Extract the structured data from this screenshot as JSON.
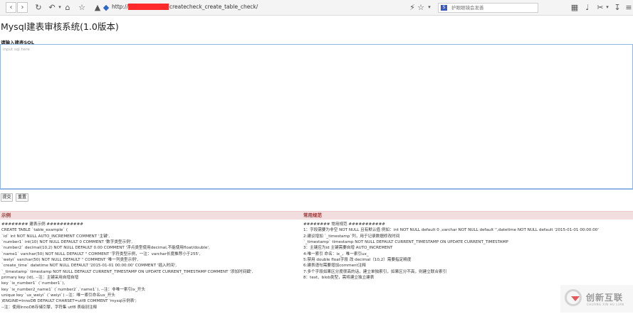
{
  "browser": {
    "url_prefix": "http://",
    "url_path": "createcheck_create_table_check/",
    "search_placeholder": "护眼眼镜会发善",
    "accent_redaction_color": "#ff2a2a"
  },
  "page": {
    "title": "Mysql建表审核系统(1.0版本)",
    "input_label": "请输入建表SQL",
    "input_placeholder": "input sql here",
    "submit_label": "提交",
    "reset_label": "重置"
  },
  "example_panel": {
    "title": "示例",
    "lines": [
      "######## 建表示例 ###########",
      "CREATE TABLE `table_example` (",
      "`id` int NOT NULL AUTO_INCREMENT COMMENT '主键',",
      "`number1` int(10) NOT NULL DEFAULT 0 COMMENT '数字类型示例',",
      "`number2` decimal(10,2) NOT NULL DEFAULT 0.00 COMMENT '浮点类型使用decimal,不能使用float/double',",
      "`name1` varchar(50) NOT NULL DEFAULT '' COMMENT '字符类型示例，一注：varchar长度推荐小于255',",
      "`weiyi` varchar(50) NOT NULL DEFAULT '' COMMENT '唯一列类型示例',",
      "`create_time` datetime NOT NULL DEFAULT '2015-01-01 00:00:00' COMMENT '插入时间',",
      "`_timestamp` timestamp NOT NULL DEFAULT CURRENT_TIMESTAMP ON UPDATE CURRENT_TIMESTAMP COMMENT '添加时间戳',",
      "primary key (id), --注：主键采用自增自增",
      "key `ix_number1` (`number1`),",
      "key `ix_number2_name1` (`number2`,`name1`), --注：非唯一索引ix_开头",
      "unique key `ux_weiyi` (`weiyi`) --注：唯一索引命名ux_开头",
      ")ENGINE=InnoDB DEFAULT CHARSET=utf8 COMMENT 'mysql示例表';",
      "--注：使用InnoDB存储引擎，字符集 utf8 表级别注释"
    ]
  },
  "rules_panel": {
    "title": "常用规范",
    "lines": [
      "######## 常用规范 ###########",
      "1：字段需要为非空 NOT NULL 且有默认值 例如：int NOT NULL default 0 ,varchar NOT NULL default '',datetime NOT NULL default '2015-01-01 00:00:00'",
      "2:建议增加 `_timestamp`列，用于记录数据修改时间",
      "`_timestamp` timestamp NOT NULL DEFAULT CURRENT_TIMESTAMP ON UPDATE CURRENT_TIMESTAMP",
      "3：主键应为id 主键需要自增 AUTO_INCREMENT",
      "4:唯一索引 命名：ix_，唯一索引ux_",
      "5:禁用 double float字段 改 decimal（10,2）需要指定精度",
      "6:建表语句需要增加comment注释",
      "7:多个字段如果区分度很高的话，建立单独索引，如果区分不高，则建立联合索引",
      "8：text、blob类型，需将建立独立建表"
    ]
  },
  "watermark": {
    "brand": "创新互联",
    "sub": "CHUANG XIN HU LIAN"
  }
}
